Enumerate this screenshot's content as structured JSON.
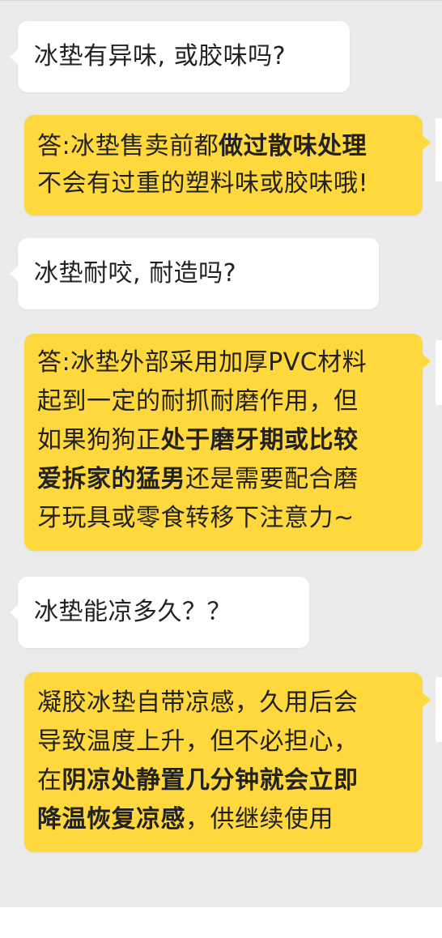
{
  "chat": {
    "q1": "冰垫有异味, 或胶味吗?",
    "a1": {
      "l1_normal": "答:冰垫售卖前都",
      "l1_bold": "做过散味处理",
      "l2": "不会有过重的塑料味或胶味哦!"
    },
    "q2": "冰垫耐咬, 耐造吗?",
    "a2": {
      "l1": "答:冰垫外部采用加厚PVC材料",
      "l2": "起到一定的耐抓耐磨作用，但",
      "l3_normal": "如果狗狗正",
      "l3_bold": "处于磨牙期或比较",
      "l4_bold": "爱拆家的猛男",
      "l4_normal": "还是需要配合磨",
      "l5": "牙玩具或零食转移下注意力~"
    },
    "q3": "冰垫能凉多久？？",
    "a3": {
      "l1": "凝胶冰垫自带凉感，久用后会",
      "l2": "导致温度上升，但不必担心，",
      "l3_normal": "在",
      "l3_bold": "阴凉处静置几分钟就会立即",
      "l4_bold": "降温恢复凉感",
      "l4_normal": "，供继续使用"
    }
  },
  "colors": {
    "background": "#ebebeb",
    "question_bubble": "#ffffff",
    "answer_bubble": "#ffd83e",
    "text": "#222222"
  }
}
